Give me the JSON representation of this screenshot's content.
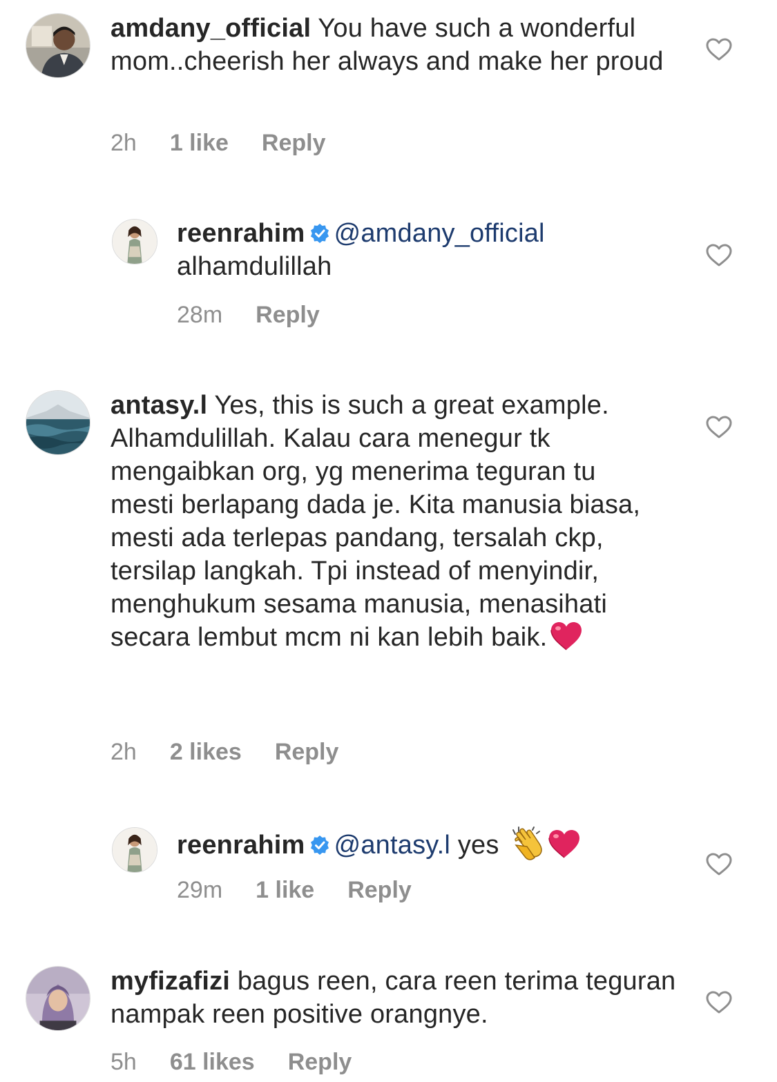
{
  "comments": [
    {
      "username": "amdany_official",
      "text": "You have such a wonderful mom..cheerish her always and make her proud",
      "time": "2h",
      "likes": "1 like",
      "reply": "Reply",
      "avatar_icon": "person-photo-icon"
    },
    {
      "username": "reenrahim",
      "mention": "@amdany_official",
      "text": "alhamdulillah",
      "time": "28m",
      "reply": "Reply",
      "verified": true
    },
    {
      "username": "antasy.l",
      "text": "Yes, this is such a great example. Alhamdulillah. Kalau cara menegur tk mengaibkan org, yg menerima teguran tu mesti berlapang dada je. Kita manusia biasa, mesti ada terlepas pandang, tersalah ckp, tersilap langkah. Tpi instead of menyindir, menghukum sesama manusia, menasihati secara lembut mcm ni kan lebih baik.",
      "time": "2h",
      "likes": "2 likes",
      "reply": "Reply",
      "trailing_emoji": "red-heart-emoji"
    },
    {
      "username": "reenrahim",
      "mention": "@antasy.l",
      "text": "yes",
      "time": "29m",
      "likes": "1 like",
      "reply": "Reply",
      "verified": true,
      "trailing_emoji": [
        "clapping-hands-emoji",
        "red-heart-emoji"
      ]
    },
    {
      "username": "myfizafizi",
      "text": "bagus reen, cara reen terima teguran nampak reen positive orangnye.",
      "time": "5h",
      "likes": "61 likes",
      "reply": "Reply"
    }
  ],
  "colors": {
    "text": "#262626",
    "meta": "#8e8e8e",
    "mention": "#1d3b6e",
    "verified": "#3897f0",
    "heart_emoji": "#e0245e"
  }
}
